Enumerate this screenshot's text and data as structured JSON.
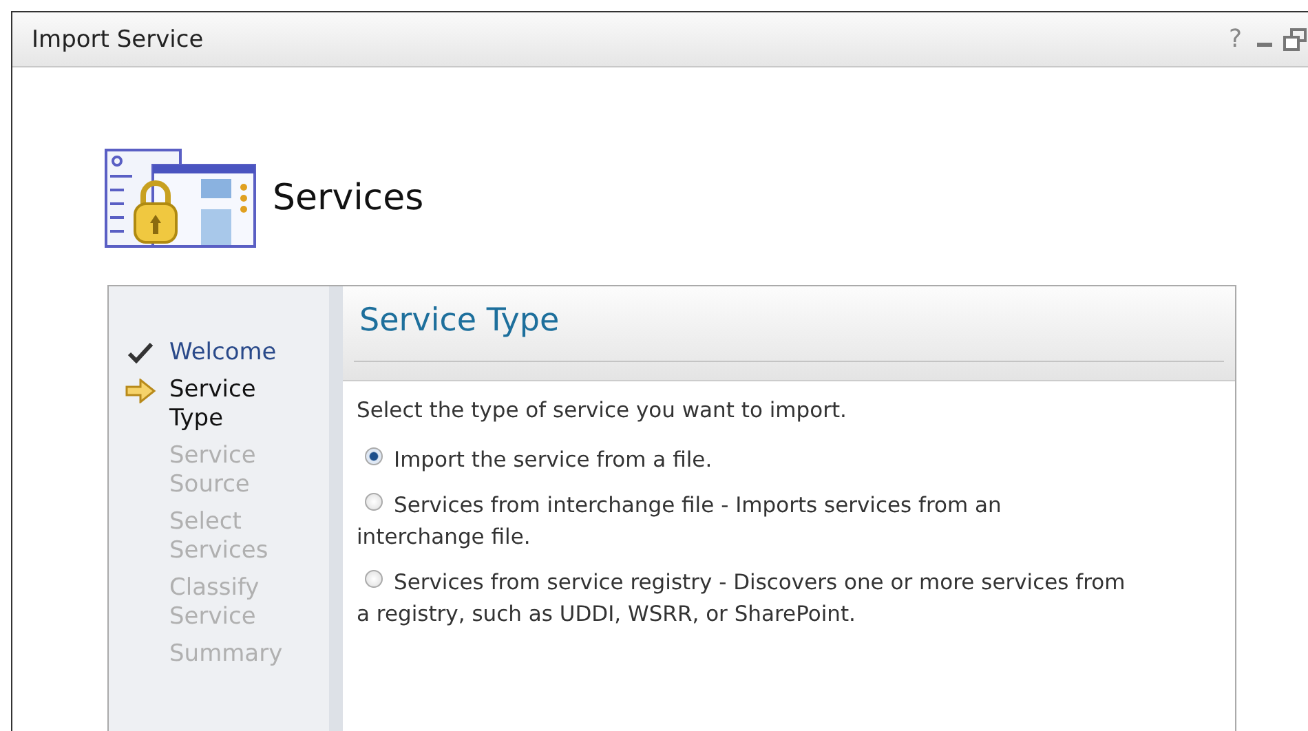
{
  "window": {
    "title": "Import Service",
    "help": "?"
  },
  "header": {
    "title": "Services"
  },
  "steps": [
    {
      "label": "Welcome",
      "kind": "done"
    },
    {
      "label": "Service Type",
      "kind": "current"
    },
    {
      "label": "Service Source",
      "kind": "pending"
    },
    {
      "label": "Select Services",
      "kind": "pending"
    },
    {
      "label": "Classify Service",
      "kind": "pending"
    },
    {
      "label": "Summary",
      "kind": "pending"
    }
  ],
  "page": {
    "title": "Service Type",
    "instruction": "Select the type of service you want to import.",
    "options": [
      {
        "label": "Import the service from a file.",
        "selected": true
      },
      {
        "label": "Services from interchange file - Imports services from an interchange file.",
        "selected": false
      },
      {
        "label": "Services from service registry - Discovers one or more services from a registry, such as UDDI, WSRR, or SharePoint.",
        "selected": false
      }
    ]
  }
}
